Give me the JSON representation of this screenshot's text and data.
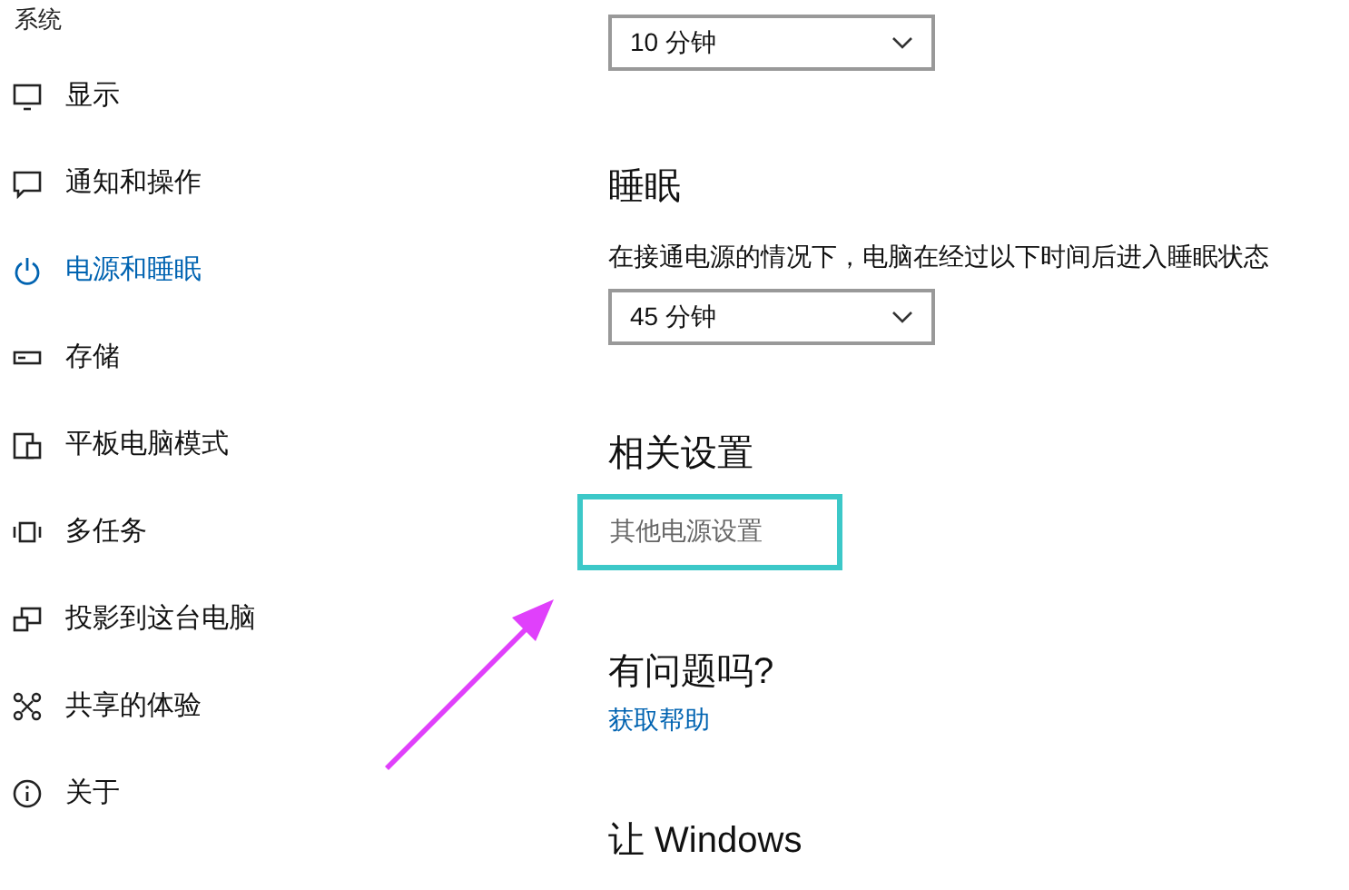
{
  "sidebar": {
    "header": "系统",
    "items": [
      {
        "label": "显示",
        "kind": "monitor",
        "selected": false
      },
      {
        "label": "通知和操作",
        "kind": "message",
        "selected": false
      },
      {
        "label": "电源和睡眠",
        "kind": "power",
        "selected": true
      },
      {
        "label": "存储",
        "kind": "storage",
        "selected": false
      },
      {
        "label": "平板电脑模式",
        "kind": "tablet",
        "selected": false
      },
      {
        "label": "多任务",
        "kind": "multitask",
        "selected": false
      },
      {
        "label": "投影到这台电脑",
        "kind": "project",
        "selected": false
      },
      {
        "label": "共享的体验",
        "kind": "share",
        "selected": false
      },
      {
        "label": "关于",
        "kind": "info",
        "selected": false
      }
    ]
  },
  "screen_dropdown": {
    "value": "10 分钟"
  },
  "sleep": {
    "heading": "睡眠",
    "description": "在接通电源的情况下，电脑在经过以下时间后进入睡眠状态",
    "dropdown": {
      "value": "45 分钟"
    }
  },
  "related": {
    "heading": "相关设置",
    "link": "其他电源设置",
    "highlighted": true
  },
  "help": {
    "heading": "有问题吗?",
    "link": "获取帮助"
  },
  "footer_heading": "让 Windows"
}
